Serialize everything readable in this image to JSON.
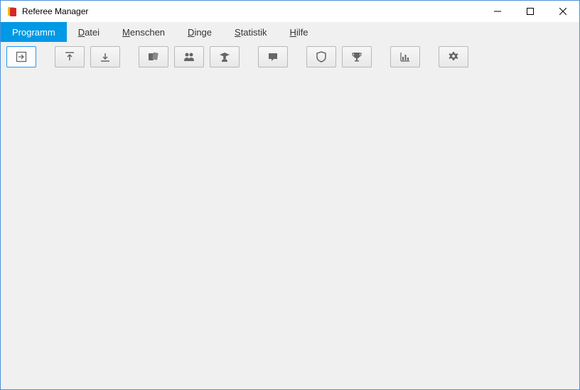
{
  "window": {
    "title": "Referee Manager"
  },
  "menu": {
    "items": [
      {
        "label": "Programm",
        "accel": "P",
        "active": true
      },
      {
        "label": "Datei",
        "accel": "D",
        "active": false
      },
      {
        "label": "Menschen",
        "accel": "M",
        "active": false
      },
      {
        "label": "Dinge",
        "accel": "D",
        "active": false
      },
      {
        "label": "Statistik",
        "accel": "S",
        "active": false
      },
      {
        "label": "Hilfe",
        "accel": "H",
        "active": false
      }
    ]
  },
  "toolbar": {
    "buttons": [
      {
        "name": "exit-button",
        "icon": "exit-icon",
        "group": 0,
        "selected": true
      },
      {
        "name": "upload-button",
        "icon": "upload-icon",
        "group": 1
      },
      {
        "name": "download-button",
        "icon": "download-icon",
        "group": 1
      },
      {
        "name": "referees-button",
        "icon": "referee-cards-icon",
        "group": 2
      },
      {
        "name": "people-button",
        "icon": "people-icon",
        "group": 2
      },
      {
        "name": "trainee-button",
        "icon": "trainee-icon",
        "group": 2
      },
      {
        "name": "message-button",
        "icon": "message-icon",
        "group": 3
      },
      {
        "name": "shield-button",
        "icon": "shield-icon",
        "group": 4
      },
      {
        "name": "trophy-button",
        "icon": "trophy-icon",
        "group": 4
      },
      {
        "name": "statistics-button",
        "icon": "chart-icon",
        "group": 5
      },
      {
        "name": "settings-button",
        "icon": "gear-icon",
        "group": 6
      }
    ]
  }
}
